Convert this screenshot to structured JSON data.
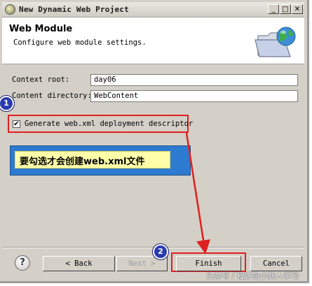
{
  "window": {
    "title": "New Dynamic Web Project",
    "controls": {
      "minimize": "_",
      "maximize": "□",
      "close": "✕"
    }
  },
  "header": {
    "title": "Web Module",
    "subtitle": "Configure web module settings.",
    "icon": "folder-globe-icon"
  },
  "form": {
    "context_root": {
      "label": "Context root:",
      "value": "day06"
    },
    "content_directory": {
      "label": "Content directory:",
      "value": "WebContent"
    },
    "generate_descriptor": {
      "label": "Generate web.xml deployment descriptor",
      "checked": true,
      "mark": "✔"
    }
  },
  "annotations": {
    "callout_text": "要勾选才会创建web.xml文件",
    "badge1": "1",
    "badge2": "2",
    "accent_red": "#e02020",
    "callout_blue": "#2d7bd0",
    "badge_blue": "#2a3bb0"
  },
  "buttons": {
    "help": "?",
    "back": "< Back",
    "next": "Next >",
    "finish": "Finish",
    "cancel": "Cancel"
  },
  "watermark": "头条号 / 程序员小新人学习"
}
